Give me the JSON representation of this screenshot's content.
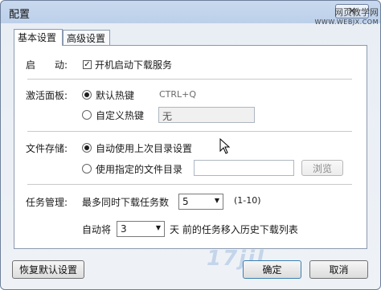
{
  "window": {
    "title": "配置",
    "close_symbol": "✕"
  },
  "watermark": {
    "top_line1": "网页教学网",
    "top_line2": "WWW.WEBJX.COM",
    "bottom": "17jil"
  },
  "tabs": [
    {
      "label": "基本设置",
      "active": true
    },
    {
      "label": "高级设置",
      "active": false
    }
  ],
  "startup": {
    "label": "启　　动:",
    "checkbox_label": "开机启动下载服务",
    "checked": true
  },
  "activate_panel": {
    "label": "激活面板:",
    "option_default": "默认热键",
    "default_hotkey": "CTRL+Q",
    "option_custom": "自定义热键",
    "custom_hotkey_value": "无",
    "selected": "default"
  },
  "file_storage": {
    "label": "文件存储:",
    "option_last": "自动使用上次目录设置",
    "option_specified": "使用指定的文件目录",
    "path_value": "",
    "browse_label": "浏览",
    "selected": "last"
  },
  "task_management": {
    "label": "任务管理:",
    "max_tasks_label": "最多同时下载任务数",
    "max_tasks_value": "5",
    "max_tasks_range": "(1-10)",
    "auto_prefix": "自动将",
    "auto_days_value": "3",
    "auto_suffix": "天 前的任务移入历史下载列表"
  },
  "footer": {
    "restore_label": "恢复默认设置",
    "ok_label": "确定",
    "cancel_label": "取消"
  },
  "colors": {
    "title_bar": "#c9d9ee",
    "panel_bg": "#ffffff",
    "border": "#8b9ab0"
  }
}
